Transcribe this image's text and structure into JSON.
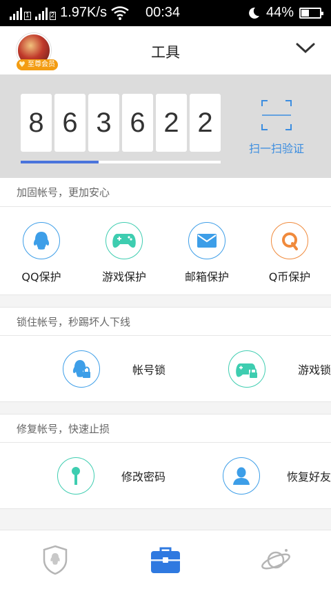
{
  "status_bar": {
    "sim1": "1",
    "sim2": "2",
    "speed": "1.97K/s",
    "time": "00:34",
    "battery_percent": "44%",
    "battery_level": 0.44
  },
  "header": {
    "title": "工具",
    "avatar_badge": "至尊会员"
  },
  "token": {
    "digits": [
      "8",
      "6",
      "3",
      "6",
      "2",
      "2"
    ],
    "progress": 0.39,
    "scan_label": "扫一扫验证"
  },
  "sections": {
    "reinforce": {
      "label": "加固帐号，更加安心",
      "items": [
        {
          "label": "QQ保护",
          "icon": "qq-penguin-icon",
          "color": "#3d9ee8"
        },
        {
          "label": "游戏保护",
          "icon": "gamepad-icon",
          "color": "#3ecdb0"
        },
        {
          "label": "邮箱保护",
          "icon": "mail-icon",
          "color": "#3d9ee8"
        },
        {
          "label": "Q币保护",
          "icon": "q-coin-icon",
          "color": "#f08a3c"
        }
      ]
    },
    "lock": {
      "label": "锁住帐号，秒踢坏人下线",
      "items": [
        {
          "label": "帐号锁",
          "icon": "account-lock-icon",
          "color": "#3d9ee8"
        },
        {
          "label": "游戏锁",
          "icon": "game-lock-icon",
          "color": "#3ecdb0"
        }
      ]
    },
    "repair": {
      "label": "修复帐号，快速止损",
      "items": [
        {
          "label": "修改密码",
          "icon": "key-icon",
          "color": "#3ecdb0"
        },
        {
          "label": "恢复好友",
          "icon": "person-icon",
          "color": "#3d9ee8"
        }
      ]
    }
  },
  "bottom_nav": [
    {
      "icon": "shield-penguin-icon",
      "active": false
    },
    {
      "icon": "toolbox-icon",
      "active": true
    },
    {
      "icon": "planet-icon",
      "active": false
    }
  ]
}
